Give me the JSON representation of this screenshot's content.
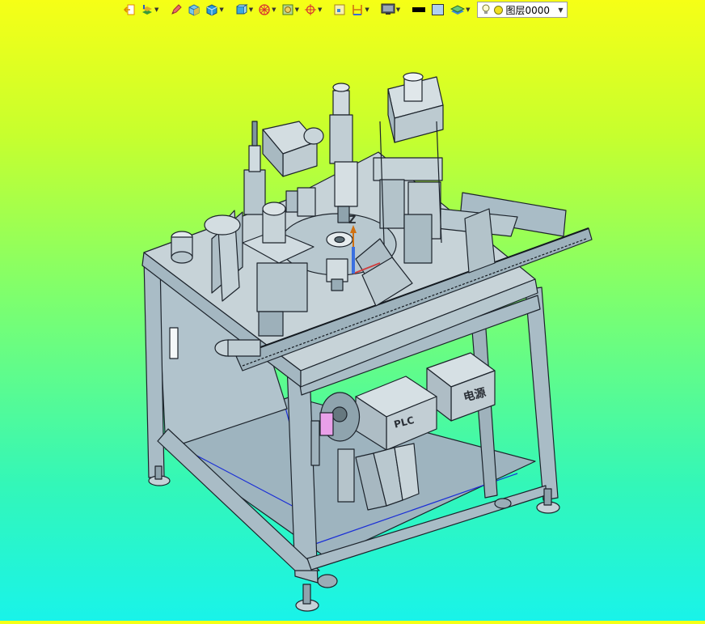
{
  "toolbar": {
    "items": [
      {
        "icon": "exit-icon",
        "dropdown": false
      },
      {
        "icon": "layers-stack-icon",
        "dropdown": true
      },
      {
        "icon": "pencil-icon",
        "dropdown": false
      },
      {
        "icon": "shaded-cube-icon",
        "dropdown": false
      },
      {
        "icon": "blue-cube-icon",
        "dropdown": true
      },
      {
        "icon": "cube-view-icon",
        "dropdown": true
      },
      {
        "icon": "sphere-wire-icon",
        "dropdown": true
      },
      {
        "icon": "image-view-icon",
        "dropdown": true
      },
      {
        "icon": "target-axis-icon",
        "dropdown": true
      },
      {
        "icon": "frame-box-icon",
        "dropdown": false
      },
      {
        "icon": "dimension-icon",
        "dropdown": true
      },
      {
        "icon": "monitor-icon",
        "dropdown": true
      },
      {
        "icon": "line-color-icon",
        "dropdown": false
      },
      {
        "icon": "fill-color-icon",
        "dropdown": false
      },
      {
        "icon": "layer-plane-icon",
        "dropdown": true
      }
    ],
    "layer": {
      "name": "图层0000"
    }
  },
  "model": {
    "labels": {
      "plc": "PLC",
      "power": "电源"
    },
    "axis": {
      "z": "Z"
    },
    "colors": {
      "frame": "#a9bcc6",
      "edge": "#1c232b",
      "panel": "#c7d3d8",
      "accent": "#e9a0e9"
    }
  }
}
